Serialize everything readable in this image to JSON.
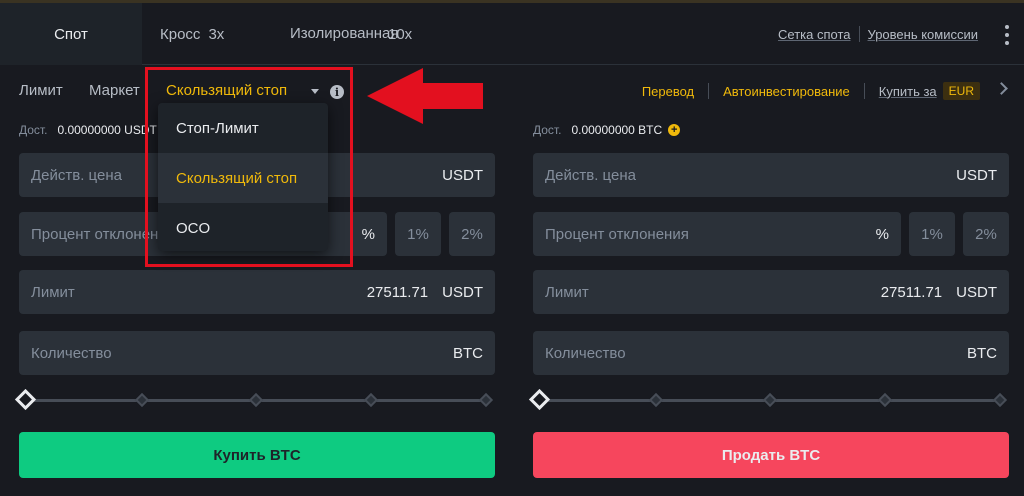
{
  "tabs": {
    "spot": "Спот",
    "cross": "Кросс",
    "cross_lev": "3x",
    "isolated": "Изолированная",
    "isolated_lev": "10x",
    "spot_grid": "Сетка спота",
    "fee_level": "Уровень комиссии"
  },
  "order_types": {
    "limit": "Лимит",
    "market": "Маркет",
    "trailing": "Скользящий стоп"
  },
  "dropdown": {
    "items": [
      "Стоп-Лимит",
      "Скользящий стоп",
      "OCO"
    ],
    "selected": "Скользящий стоп"
  },
  "right_links": {
    "transfer": "Перевод",
    "autoinvest": "Автоинвестирование",
    "buy_with": "Купить за",
    "currency": "EUR"
  },
  "buy": {
    "avail_label": "Дост.",
    "avail_value": "0.00000000 USDT",
    "trigger_ph": "Действ. цена",
    "trigger_unit": "USDT",
    "delta_ph": "Процент отклонения",
    "delta_unit": "%",
    "pct1": "1%",
    "pct2": "2%",
    "limit_ph": "Лимит",
    "limit_value": "27511.71",
    "limit_unit": "USDT",
    "qty_ph": "Количество",
    "qty_unit": "BTC",
    "button": "Купить BTC"
  },
  "sell": {
    "avail_label": "Дост.",
    "avail_value": "0.00000000 BTC",
    "trigger_ph": "Действ. цена",
    "trigger_unit": "USDT",
    "delta_ph": "Процент отклонения",
    "delta_unit": "%",
    "pct1": "1%",
    "pct2": "2%",
    "limit_ph": "Лимит",
    "limit_value": "27511.71",
    "limit_unit": "USDT",
    "qty_ph": "Количество",
    "qty_unit": "BTC",
    "button": "Продать BTC"
  },
  "icons": {
    "info": "info-icon",
    "plus": "plus-circle-icon",
    "more": "kebab-menu-icon",
    "chevron": "chevron-right-icon"
  },
  "colors": {
    "accent": "#f0b90b",
    "buy": "#0ecb81",
    "sell": "#f6465d",
    "annotation": "#e3101f"
  },
  "slider": {
    "buy_level": 0,
    "sell_level": 0
  }
}
